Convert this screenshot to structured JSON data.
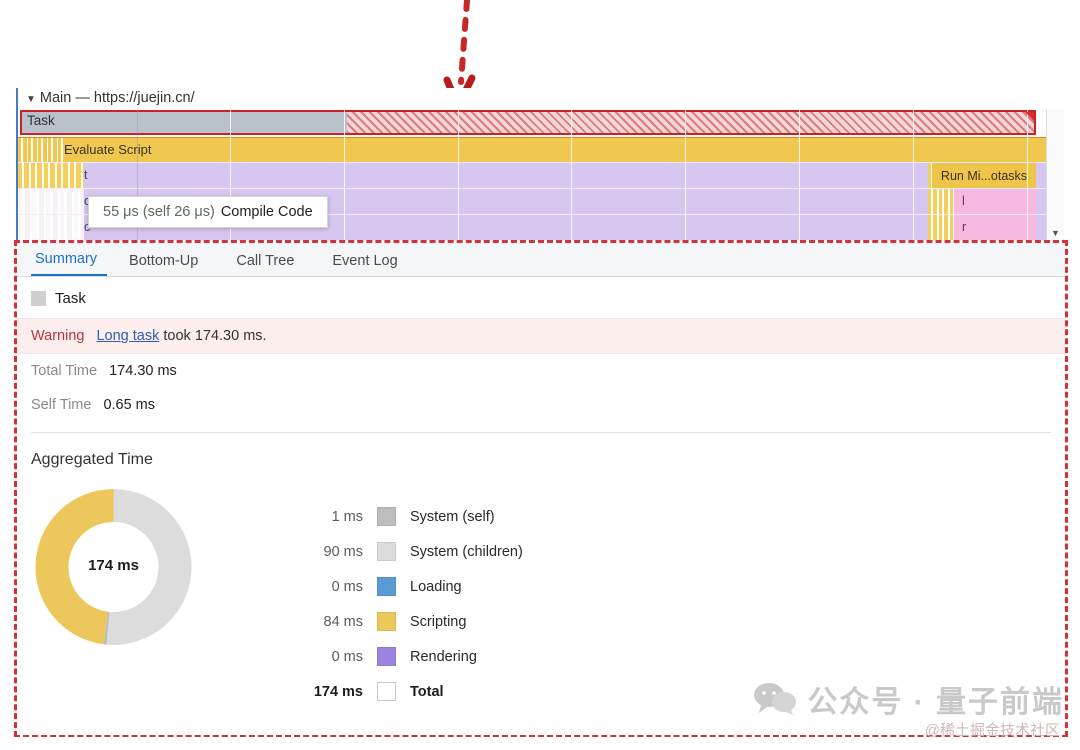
{
  "timeline": {
    "header_caret": "▼",
    "header_title": "Main — https://juejin.cn/",
    "task_label": "Task",
    "eval_label": "Evaluate Script",
    "row1_label": "t",
    "row2_label": "c",
    "row3_label": "c",
    "run_microtasks_label": "Run Mi...otasks",
    "pink1_label": "l",
    "pink2_label": "r",
    "scroll_down_icon": "▼",
    "colors": {
      "task_fill": "#b9c2ca",
      "task_border": "#cc2222",
      "task_hatch": "#e2a3a8",
      "evaluate_script": "#f0c850",
      "purple_row": "#d7c6ef",
      "run_microtasks": "#eec549",
      "pink_block": "#f7b9df"
    }
  },
  "tooltip": {
    "duration": "55 μs (self 26 μs)",
    "name": "Compile Code"
  },
  "summary": {
    "tabs": [
      {
        "label": "Summary",
        "active": true
      },
      {
        "label": "Bottom-Up",
        "active": false
      },
      {
        "label": "Call Tree",
        "active": false
      },
      {
        "label": "Event Log",
        "active": false
      }
    ],
    "selected_event": "Task",
    "selected_event_color": "#cfcfcf",
    "warning": {
      "label": "Warning",
      "link": "Long task",
      "rest": " took 174.30 ms.",
      "label_color": "#b5373e",
      "link_color": "#2a5fb4",
      "background": "#fdeeee"
    },
    "total_time": {
      "key": "Total Time",
      "value": "174.30 ms"
    },
    "self_time": {
      "key": "Self Time",
      "value": "0.65 ms"
    },
    "aggregated_title": "Aggregated Time",
    "donut_center": "174 ms"
  },
  "chart_data": {
    "type": "pie",
    "title": "Aggregated Time",
    "center_label": "174 ms",
    "unit": "ms",
    "categories": [
      "System (self)",
      "System (children)",
      "Loading",
      "Scripting",
      "Rendering"
    ],
    "values": [
      1,
      90,
      0,
      84,
      0
    ],
    "labels": [
      "1 ms",
      "90 ms",
      "0 ms",
      "84 ms",
      "0 ms"
    ],
    "colors": [
      "#bdbdbd",
      "#dcdcdc",
      "#5b9bd5",
      "#ecc75b",
      "#9a84e0"
    ],
    "total": {
      "label": "Total",
      "value": 174,
      "display": "174 ms",
      "color": "#ffffff"
    },
    "legend_position": "right",
    "donut": true
  },
  "watermark": {
    "main": "公众号 · 量子前端",
    "sub": "@稀土掘金技术社区"
  }
}
